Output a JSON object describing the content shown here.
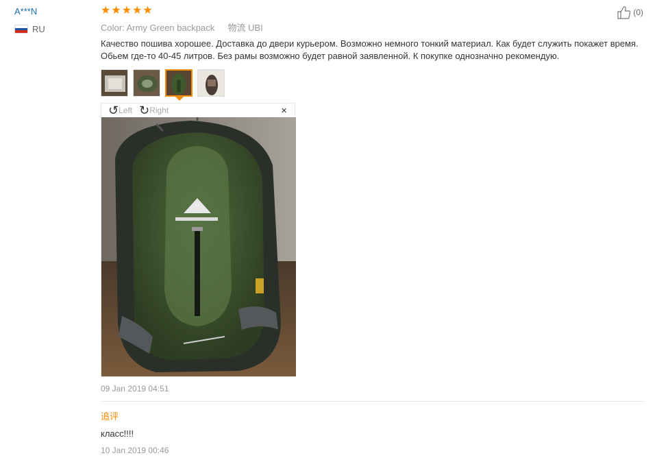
{
  "user": {
    "name": "A***N",
    "country": "RU",
    "flag_colors": [
      "#ffffff",
      "#1c57a5",
      "#d52b1e"
    ]
  },
  "review": {
    "rating": 5,
    "stars": [
      "★",
      "★",
      "★",
      "★",
      "★"
    ],
    "star_color": "#ff8c00",
    "likes": "(0)",
    "color_label": "Color:",
    "color_value": "Army Green backpack",
    "shipping_label": "物流",
    "shipping_value": "UBI",
    "text": "Качество пошива хорошее. Доставка до двери курьером. Возможно немного тонкий материал. Как будет служить покажет время. Обьем где-то 40-45 литров. Без рамы возможно будет равной заявленной. К покупке однозначно рекомендую.",
    "thumbnails": [
      "photo-1",
      "photo-2",
      "photo-3",
      "photo-4"
    ],
    "active_thumbnail": 2,
    "date": "09 Jan 2019 04:51"
  },
  "viewer": {
    "rotate_left": "Left",
    "rotate_right": "Right",
    "close": "×"
  },
  "followup": {
    "title": "追评",
    "text": "класс!!!!",
    "date": "10 Jan 2019 00:46"
  },
  "accent_color": "#f28c00",
  "link_color": "#1a6fb0"
}
